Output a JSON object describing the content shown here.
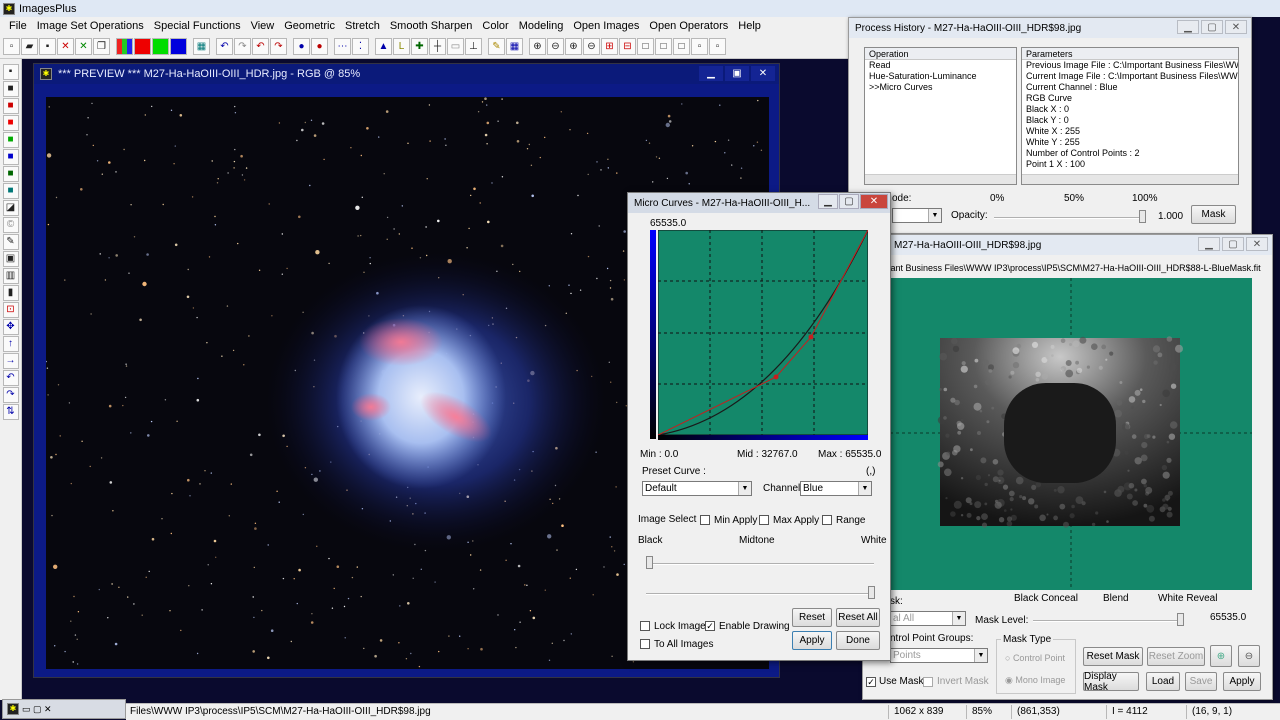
{
  "app": {
    "title": "ImagesPlus"
  },
  "menu": [
    "File",
    "Image Set Operations",
    "Special Functions",
    "View",
    "Geometric",
    "Stretch",
    "Smooth Sharpen",
    "Color",
    "Modeling",
    "Open Images",
    "Open Operators",
    "Help"
  ],
  "preview": {
    "title": "*** PREVIEW *** M27-Ha-HaOIII-OIII_HDR.jpg - RGB @ 85%"
  },
  "micro": {
    "title": "Micro Curves - M27-Ha-HaOIII-OIII_H...",
    "top_value": "65535.0",
    "min": "Min :  0.0",
    "mid": "Mid :  32767.0",
    "max": "Max :  65535.0",
    "paren": "(,)",
    "preset_label": "Preset Curve :",
    "preset_value": "Default",
    "channel_label": "Channel:",
    "channel_value": "Blue",
    "image_select": "Image Select",
    "min_apply": "Min Apply",
    "max_apply": "Max Apply",
    "range": "Range",
    "black": "Black",
    "midtone": "Midtone",
    "white": "White",
    "lock_image": "Lock Image",
    "enable_drawing": "Enable Drawing",
    "to_all": "To All Images",
    "reset": "Reset",
    "reset_all": "Reset All",
    "apply": "Apply",
    "done": "Done",
    "colors": {
      "grid": "#14886a",
      "curve": "#1a1a1a",
      "points": "#c81e1e"
    }
  },
  "history": {
    "title": "Process History - M27-Ha-HaOIII-OIII_HDR$98.jpg",
    "op_header": "Operation",
    "param_header": "Parameters",
    "operations": [
      "Read",
      "Hue-Saturation-Luminance",
      ">>Micro Curves"
    ],
    "parameters": [
      "Previous Image File : C:\\Important Business Files\\WW",
      "Current Image File : C:\\Important Business Files\\WW",
      "Current Channel : Blue",
      "RGB Curve",
      " Black X : 0",
      " Black Y : 0",
      " White X : 255",
      " White Y : 255",
      " Number of Control Points : 2",
      "  Point 1 X : 100"
    ],
    "mode_label": "ode:",
    "pct0": "0%",
    "pct50": "50%",
    "pct100": "100%",
    "opacity_label": "Opacity:",
    "opacity_value": "1.000",
    "mask_btn": "Mask"
  },
  "mask": {
    "title": "ace - M27-Ha-HaOIII-OIII_HDR$98.jpg",
    "path": "portant Business Files\\WWW IP3\\process\\IP5\\SCM\\M27-Ha-HaOIII-OIII_HDR$88-L-BlueMask.fit",
    "mask_label": "sk:",
    "mask_select": "al All",
    "black_conceal": "Black Conceal",
    "blend": "Blend",
    "white_reveal": "White Reveal",
    "mask_level": "Mask Level:",
    "level_value": "65535.0",
    "groups_label": "ntrol Point Groups:",
    "groups_select": "Points",
    "mask_type": "Mask Type",
    "control_point": "Control Point",
    "mono_image": "Mono Image",
    "reset_mask": "Reset Mask",
    "reset_zoom": "Reset Zoom",
    "use_mask": "Use Mask",
    "invert_mask": "Invert Mask",
    "display_mask": "Display Mask",
    "load": "Load",
    "save": "Save",
    "apply": "Apply"
  },
  "status": {
    "path": "Files\\WWW IP3\\process\\IP5\\SCM\\M27-Ha-HaOIII-OIII_HDR$98.jpg",
    "dims": "1062 x 839",
    "zoom": "85%",
    "coords": "(861,353)",
    "intensity": "I = 4112",
    "rgb": "(16, 9, 1)"
  }
}
